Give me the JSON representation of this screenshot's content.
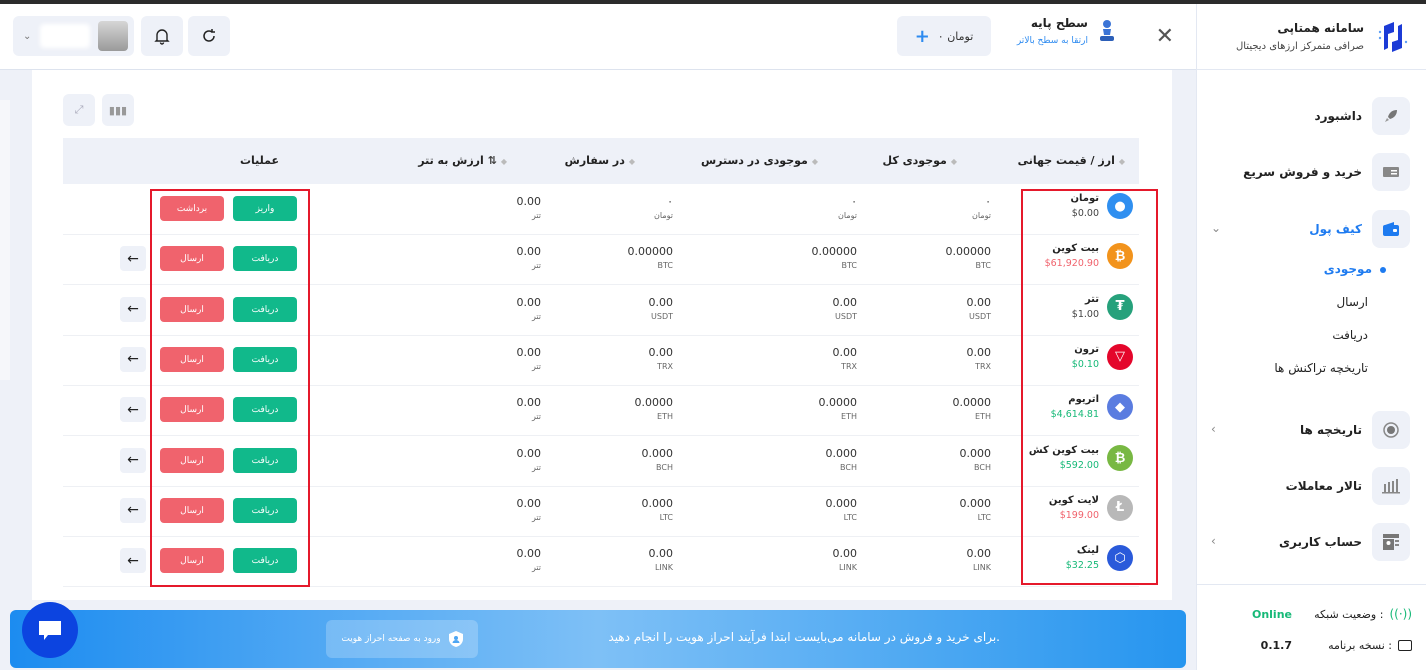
{
  "brand": {
    "title": "سامانه همتاپی",
    "subtitle": "صرافی متمرکز ارزهای دیجیتال"
  },
  "header": {
    "plan_title": "سطح پایه",
    "plan_upgrade": "ارتقا به سطح بالاتر",
    "balance_label": "۰ تومان",
    "icons": [
      "close-icon",
      "pawn-icon",
      "plus-icon",
      "refresh-icon",
      "bell-icon",
      "avatar",
      "chevron-down-icon"
    ]
  },
  "sidebar": {
    "items": [
      {
        "label": "داشبورد",
        "icon": "rocket-icon"
      },
      {
        "label": "خرید و فروش سریع",
        "icon": "cash-icon"
      },
      {
        "label": "کیف پول",
        "icon": "wallet-icon",
        "active": true
      },
      {
        "label": "تاریخچه ها",
        "icon": "history-icon"
      },
      {
        "label": "تالار معاملات",
        "icon": "chart-icon"
      },
      {
        "label": "حساب کاربری",
        "icon": "profile-icon"
      }
    ],
    "wallet_sub": [
      "موجودی",
      "ارسال",
      "دریافت",
      "تاریخچه تراکنش ها"
    ],
    "footer": {
      "network_label": "وضعیت شبکه :",
      "network_value": "Online",
      "version_label": "نسخه برنامه :",
      "version_value": "0.1.7"
    }
  },
  "table": {
    "headers": [
      "ارز / قیمت جهانی",
      "موجودی کل",
      "موجودی در دسترس",
      "در سفارش",
      "ارزش به تتر",
      "عملیات"
    ],
    "rows": [
      {
        "name": "تومان",
        "price": "$0.00",
        "price_color": "#444444",
        "icon_color": "#2f8ff0",
        "icon_glyph": "●",
        "total": "۰",
        "total_unit": "تومان",
        "available": "۰",
        "available_unit": "تومان",
        "order": "۰",
        "order_unit": "تومان",
        "usdt": "0.00",
        "usdt_unit": "تتر",
        "btn1": "واریز",
        "btn2": "برداشت"
      },
      {
        "name": "بیت کوین",
        "price": "$61,920.90",
        "price_color": "#f0636d",
        "icon_color": "#f2931c",
        "icon_glyph": "₿",
        "total": "0.00000",
        "total_unit": "BTC",
        "available": "0.00000",
        "available_unit": "BTC",
        "order": "0.00000",
        "order_unit": "BTC",
        "usdt": "0.00",
        "usdt_unit": "تتر",
        "btn1": "دریافت",
        "btn2": "ارسال"
      },
      {
        "name": "تتر",
        "price": "$1.00",
        "price_color": "#444444",
        "icon_color": "#26a17b",
        "icon_glyph": "₮",
        "total": "0.00",
        "total_unit": "USDT",
        "available": "0.00",
        "available_unit": "USDT",
        "order": "0.00",
        "order_unit": "USDT",
        "usdt": "0.00",
        "usdt_unit": "تتر",
        "btn1": "دریافت",
        "btn2": "ارسال"
      },
      {
        "name": "ترون",
        "price": "$0.10",
        "price_color": "#17b978",
        "icon_color": "#e4062b",
        "icon_glyph": "▽",
        "total": "0.00",
        "total_unit": "TRX",
        "available": "0.00",
        "available_unit": "TRX",
        "order": "0.00",
        "order_unit": "TRX",
        "usdt": "0.00",
        "usdt_unit": "تتر",
        "btn1": "دریافت",
        "btn2": "ارسال"
      },
      {
        "name": "اتریوم",
        "price": "$4,614.81",
        "price_color": "#17b978",
        "icon_color": "#5a7ce0",
        "icon_glyph": "◆",
        "total": "0.0000",
        "total_unit": "ETH",
        "available": "0.0000",
        "available_unit": "ETH",
        "order": "0.0000",
        "order_unit": "ETH",
        "usdt": "0.00",
        "usdt_unit": "تتر",
        "btn1": "دریافت",
        "btn2": "ارسال"
      },
      {
        "name": "بیت کوین کش",
        "price": "$592.00",
        "price_color": "#17b978",
        "icon_color": "#78b843",
        "icon_glyph": "₿",
        "total": "0.000",
        "total_unit": "BCH",
        "available": "0.000",
        "available_unit": "BCH",
        "order": "0.000",
        "order_unit": "BCH",
        "usdt": "0.00",
        "usdt_unit": "تتر",
        "btn1": "دریافت",
        "btn2": "ارسال"
      },
      {
        "name": "لایت کوین",
        "price": "$199.00",
        "price_color": "#f0636d",
        "icon_color": "#b8b8b8",
        "icon_glyph": "Ł",
        "total": "0.000",
        "total_unit": "LTC",
        "available": "0.000",
        "available_unit": "LTC",
        "order": "0.000",
        "order_unit": "LTC",
        "usdt": "0.00",
        "usdt_unit": "تتر",
        "btn1": "دریافت",
        "btn2": "ارسال"
      },
      {
        "name": "لینک",
        "price": "$32.25",
        "price_color": "#17b978",
        "icon_color": "#2a5ada",
        "icon_glyph": "⬡",
        "total": "0.00",
        "total_unit": "LINK",
        "available": "0.00",
        "available_unit": "LINK",
        "order": "0.00",
        "order_unit": "LINK",
        "usdt": "0.00",
        "usdt_unit": "تتر",
        "btn1": "دریافت",
        "btn2": "ارسال"
      }
    ]
  },
  "banner": {
    "message": "برای خرید و فروش در سامانه می‌بایست ابتدا فرآیند احراز هویت را انجام دهید.",
    "button": "ورود به صفحه احراز هویت"
  }
}
